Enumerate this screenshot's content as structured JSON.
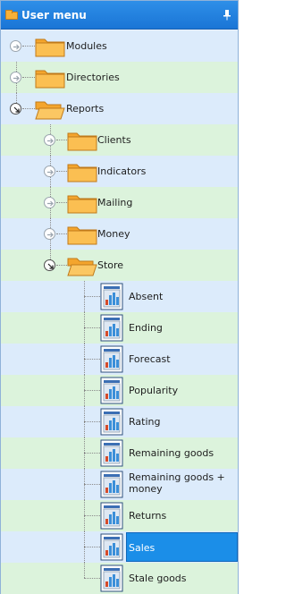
{
  "panel": {
    "title": "User menu",
    "title_icon": "folder-icon",
    "pin_icon": "pin-icon"
  },
  "colors": {
    "title_bar": "#1a75d6",
    "row_blue": "#dcebfb",
    "row_green": "#dcf3dc",
    "selection": "#1b8ee8",
    "folder": "#f6b13a"
  },
  "tree": {
    "modules": "Modules",
    "directories": "Directories",
    "reports": "Reports",
    "clients": "Clients",
    "indicators": "Indicators",
    "mailing": "Mailing",
    "money": "Money",
    "store": "Store",
    "reports_store": [
      "Absent",
      "Ending",
      "Forecast",
      "Popularity",
      "Rating",
      "Remaining goods",
      "Remaining goods + money",
      "Returns",
      "Sales",
      "Stale goods"
    ],
    "selected": "Sales"
  }
}
